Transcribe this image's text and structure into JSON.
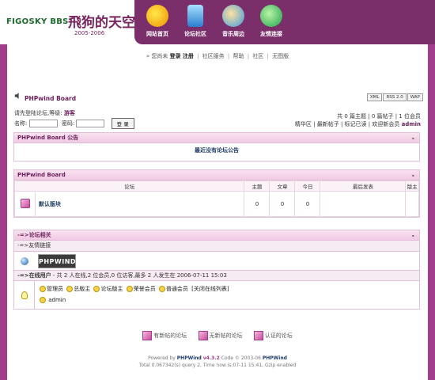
{
  "header": {
    "logo_text1": "FIGOSKY BBS",
    "logo_text2": "飛狗的天空",
    "logo_years": "2005-2006",
    "nav": [
      {
        "label": "网站首页"
      },
      {
        "label": "论坛社区"
      },
      {
        "label": "音乐周边"
      },
      {
        "label": "友情连接"
      }
    ]
  },
  "toplinks": {
    "prefix": "» 您尚未",
    "login": "登录",
    "register": "注册",
    "items": [
      "社区服务",
      "帮助",
      "社区",
      "无图版"
    ]
  },
  "board": {
    "title": "PHPwind Board",
    "formats": [
      "XML",
      "RSS 2.0",
      "WAP"
    ]
  },
  "login": {
    "notice": "请先登陆论坛,等级:",
    "level": "游客",
    "name_label": "名称:",
    "pwd_label": "密码:",
    "submit": "登 录"
  },
  "stats": {
    "line1": "共 0 篇主题 | 0 篇帖子 | 1 位会员",
    "links": [
      "精华区",
      "最新帖子",
      "标记已读",
      "欢迎新会员"
    ],
    "newest_member": "admin"
  },
  "announcement": {
    "header": "PHPwind Board 公告",
    "body": "最近没有论坛公告",
    "toggle": "-"
  },
  "forum_table": {
    "header": "PHPwind Board",
    "toggle": "-",
    "columns": [
      "论坛",
      "主题",
      "文章",
      "今日",
      "最后发表",
      "版主"
    ],
    "rows": [
      {
        "name": "默认版块",
        "topics": "0",
        "posts": "0",
        "today": "0",
        "last": "",
        "mod": ""
      }
    ]
  },
  "related": {
    "header": "-=>论坛相关",
    "toggle": "-",
    "links_label": "-=>友情链接",
    "partner_logo": "PHPWIND",
    "online_label": "-=>在线用户",
    "online_text": "- 共 2 人在线,2 位会员,0 位访客,最多 2 人发生在 2006-07-11 15:03",
    "roles": [
      "管理员",
      "总版主",
      "论坛版主",
      "荣誉会员",
      "普通会员"
    ],
    "close_list": "[关闭在线列表]",
    "online_user": "admin"
  },
  "legend": {
    "items": [
      "有新帖的论坛",
      "无新帖的论坛",
      "认证的论坛"
    ]
  },
  "footer": {
    "powered_prefix": "Powered by",
    "product": "PHPWind",
    "version": "v4.3.2",
    "code_text": "Code © 2003-06",
    "brand": "PHPWind",
    "time_line": "Total 0.067342(s) query 2, Time now is:07-11 15:41, Gzip enabled"
  },
  "colors": {
    "accent": "#a23d8c",
    "nav_bg": "#7b2f6a",
    "header_text": "#6b1f5a"
  }
}
